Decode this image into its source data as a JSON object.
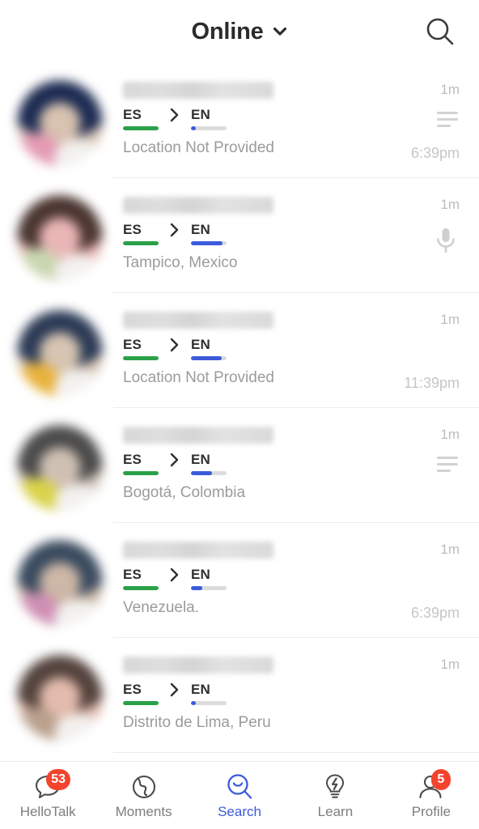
{
  "header": {
    "title": "Online",
    "chevron_icon": "chevron-down-icon",
    "search_icon": "search-icon"
  },
  "colors": {
    "accent": "#3b5bdb",
    "native_bar": "#2aa148",
    "learning_bar": "#3b5bdb",
    "bar_track": "#dcdcdc",
    "badge": "#f4442e",
    "title": "#2b2b2b",
    "muted": "#9b9b9b"
  },
  "list": {
    "rows": [
      {
        "username": "",
        "username_redacted": true,
        "native": "ES",
        "learning": "EN",
        "arrow_icon": "chevron-right-icon",
        "native_level": 100,
        "learning_level": 5,
        "location": "Location Not Provided",
        "ago": "1m",
        "time": "6:39pm",
        "pref_icon": "text-lines-icon",
        "avatar": {
          "ring": "#1d2b52",
          "tone": "#d8c2b0",
          "accent": "#e49ab4"
        }
      },
      {
        "username": "",
        "username_redacted": true,
        "native": "ES",
        "learning": "EN",
        "arrow_icon": "chevron-right-icon",
        "native_level": 100,
        "learning_level": 88,
        "location": "Tampico, Mexico",
        "ago": "1m",
        "time": "",
        "pref_icon": "microphone-icon",
        "avatar": {
          "ring": "#4a3530",
          "tone": "#e9b6b6",
          "accent": "#c9d6b0"
        }
      },
      {
        "username": "",
        "username_redacted": true,
        "native": "ES",
        "learning": "EN",
        "arrow_icon": "chevron-right-icon",
        "native_level": 100,
        "learning_level": 86,
        "location": "Location Not Provided",
        "ago": "1m",
        "time": "11:39pm",
        "pref_icon": "",
        "avatar": {
          "ring": "#2b3a55",
          "tone": "#d7c4b2",
          "accent": "#e8b23c"
        }
      },
      {
        "username": "",
        "username_redacted": true,
        "native": "ES",
        "learning": "EN",
        "arrow_icon": "chevron-right-icon",
        "native_level": 100,
        "learning_level": 60,
        "location": "Bogotá, Colombia",
        "ago": "1m",
        "time": "",
        "pref_icon": "text-lines-icon",
        "avatar": {
          "ring": "#4b4b4b",
          "tone": "#cfc0b4",
          "accent": "#d9d24a"
        }
      },
      {
        "username": "",
        "username_redacted": true,
        "native": "ES",
        "learning": "EN",
        "arrow_icon": "chevron-right-icon",
        "native_level": 100,
        "learning_level": 32,
        "location": "Venezuela.",
        "ago": "1m",
        "time": "6:39pm",
        "pref_icon": "",
        "avatar": {
          "ring": "#3a4a5e",
          "tone": "#cdb7a6",
          "accent": "#cf8fb4"
        }
      },
      {
        "username": "",
        "username_redacted": true,
        "native": "ES",
        "learning": "EN",
        "arrow_icon": "chevron-right-icon",
        "native_level": 100,
        "learning_level": 5,
        "location": "Distrito de Lima, Peru",
        "ago": "1m",
        "time": "",
        "pref_icon": "",
        "avatar": {
          "ring": "#53423c",
          "tone": "#e3bcae",
          "accent": "#b9a08c"
        }
      }
    ]
  },
  "tabbar": {
    "items": [
      {
        "label": "HelloTalk",
        "icon": "speech-bubble-icon",
        "badge": "53",
        "active": false
      },
      {
        "label": "Moments",
        "icon": "globe-icon",
        "badge": "",
        "active": false
      },
      {
        "label": "Search",
        "icon": "search-smile-icon",
        "badge": "",
        "active": true
      },
      {
        "label": "Learn",
        "icon": "lightbulb-icon",
        "badge": "",
        "active": false
      },
      {
        "label": "Profile",
        "icon": "person-icon",
        "badge": "5",
        "active": false
      }
    ]
  }
}
